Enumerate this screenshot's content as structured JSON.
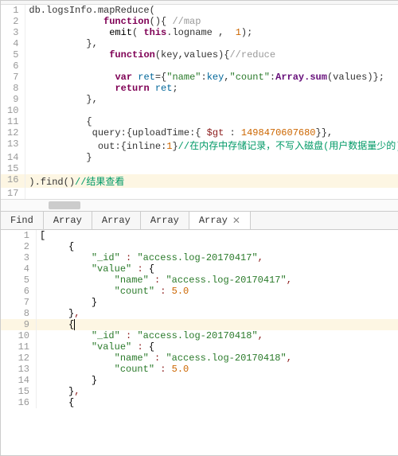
{
  "top_code": {
    "collection": "db.logsInfo.mapReduce",
    "map_fn": "function",
    "map_comment": "//map",
    "emit_call": "emit",
    "emit_arg1_this": "this",
    "emit_arg1_prop": ".logname",
    "emit_arg2": "1",
    "reduce_fn": "function",
    "reduce_params": "(key,values)",
    "reduce_comment": "//reduce",
    "var_kw": "var",
    "ret_var": "ret",
    "name_key": "\"name\"",
    "name_val": "key",
    "count_key": "\"count\"",
    "array_sum": "Array.sum",
    "sum_arg": "(values)",
    "return_kw": "return",
    "query_key": "query",
    "upload_key": "uploadTime",
    "gt_key": "$gt",
    "gt_val": "1498470607680",
    "out_key": "out",
    "inline_key": "inline",
    "inline_val": "1",
    "out_comment": "//在内存中存储记录，不写入磁盘(用户数据量少的)",
    "find_call": ").find()",
    "find_comment": "//结果查看"
  },
  "tabs": {
    "t0": "Find",
    "t1": "Array",
    "t2": "Array",
    "t3": "Array",
    "t4": "Array"
  },
  "results": {
    "id_key": "\"_id\"",
    "value_key": "\"value\"",
    "name_key": "\"name\"",
    "count_key": "\"count\"",
    "id_1": "\"access.log-20170417\"",
    "name_1": "\"access.log-20170417\"",
    "count_1": "5.0",
    "id_2": "\"access.log-20170418\"",
    "name_2": "\"access.log-20170418\"",
    "count_2": "5.0"
  }
}
